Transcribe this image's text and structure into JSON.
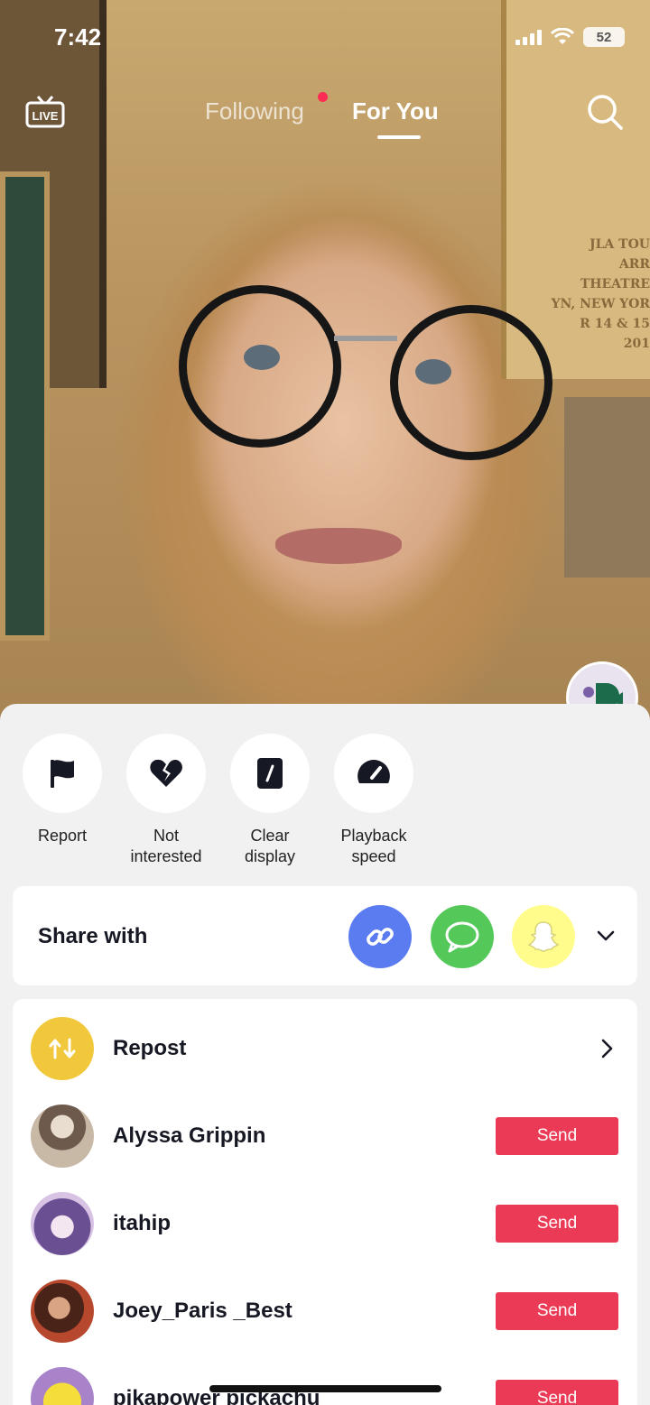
{
  "status_bar": {
    "time": "7:42",
    "battery": "52"
  },
  "top_nav": {
    "live_label": "LIVE",
    "tabs": [
      {
        "label": "Following",
        "has_notification_dot": true
      },
      {
        "label": "For You",
        "active": true
      }
    ]
  },
  "video": {
    "poster_text_lines": [
      "JLA TOU",
      "ARR THEATRE",
      "YN, NEW YOR",
      "R 14 & 15 201"
    ]
  },
  "sheet": {
    "actions": [
      {
        "label": "Report",
        "icon": "flag-icon"
      },
      {
        "label": "Not\ninterested",
        "icon": "broken-heart-icon"
      },
      {
        "label": "Clear\ndisplay",
        "icon": "clear-display-icon"
      },
      {
        "label": "Playback\nspeed",
        "icon": "speedometer-icon"
      }
    ],
    "share": {
      "title": "Share with",
      "targets": [
        {
          "icon": "link-icon",
          "color": "#5b7cf0"
        },
        {
          "icon": "message-icon",
          "color": "#54c95a"
        },
        {
          "icon": "snapchat-icon",
          "color": "#fffc8c"
        }
      ]
    },
    "list": {
      "repost": {
        "label": "Repost",
        "color": "#f1c83b"
      },
      "contacts": [
        {
          "name": "Alyssa Grippin",
          "button": "Send"
        },
        {
          "name": "itahip",
          "button": "Send"
        },
        {
          "name": "Joey_Paris _Best",
          "button": "Send"
        },
        {
          "name": "pikapower pickachu",
          "button": "Send"
        }
      ]
    },
    "accent_color": "#ea3a56"
  }
}
